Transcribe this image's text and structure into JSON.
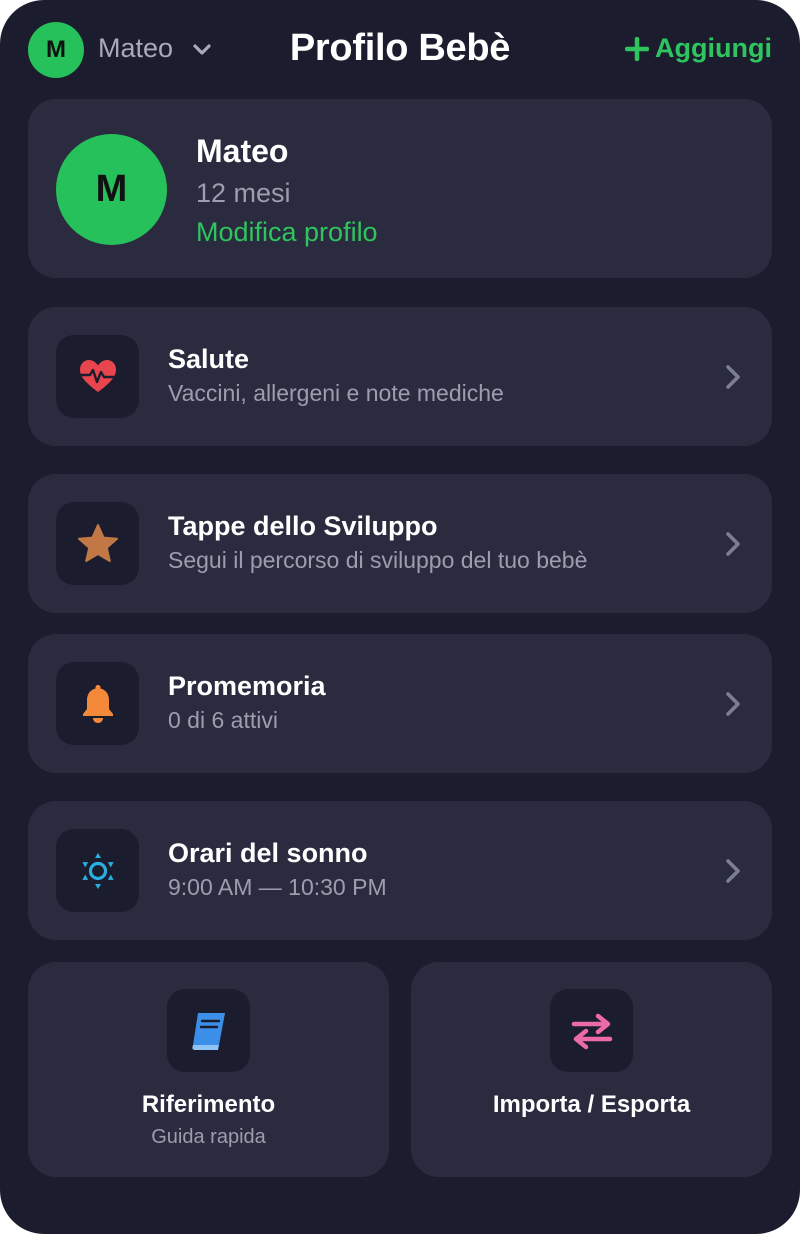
{
  "header": {
    "avatar_initial": "M",
    "child_name": "Mateo",
    "title": "Profilo Bebè",
    "add_label": "Aggiungi"
  },
  "profile": {
    "initial": "M",
    "name": "Mateo",
    "age": "12 mesi",
    "edit_label": "Modifica profilo"
  },
  "menu": [
    {
      "icon": "heart-pulse-icon",
      "title": "Salute",
      "subtitle": "Vaccini, allergeni e note mediche",
      "color": "#e8454f"
    },
    {
      "icon": "star-icon",
      "title": "Tappe dello Sviluppo",
      "subtitle": "Segui il percorso di sviluppo del tuo bebè",
      "color": "#c27845"
    },
    {
      "icon": "bell-icon",
      "title": "Promemoria",
      "subtitle": "0 di 6 attivi",
      "color": "#f5893a"
    },
    {
      "icon": "sun-icon",
      "title": "Orari del sonno",
      "subtitle": "9:00 AM — 10:30 PM",
      "color": "#2ab0e0"
    }
  ],
  "tiles": [
    {
      "icon": "book-icon",
      "title": "Riferimento",
      "subtitle": "Guida rapida",
      "color": "#3b8fe8"
    },
    {
      "icon": "arrows-exchange-icon",
      "title": "Importa / Esporta",
      "subtitle": "",
      "color": "#ec6aa8"
    }
  ],
  "colors": {
    "background": "#1b1d2e",
    "card": "#2a2b3e",
    "accent": "#2ec55e"
  }
}
